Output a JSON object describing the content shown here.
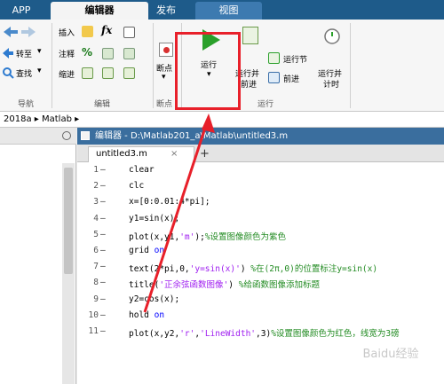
{
  "tabs": {
    "app": "APP",
    "editor": "编辑器",
    "publish": "发布",
    "view": "视图"
  },
  "ribbon": {
    "nav": {
      "forward": "转至",
      "find": "查找",
      "group": "导航"
    },
    "edit": {
      "insert": "插入",
      "comment": "注释",
      "indent": "缩进",
      "fx": "fx",
      "group": "编辑"
    },
    "breakpoint": {
      "label": "断点",
      "group": "断点"
    },
    "run": {
      "run": "运行",
      "run_advance_1": "运行并",
      "run_advance_2": "前进",
      "run_section": "运行节",
      "advance": "前进",
      "run_time_1": "运行并",
      "run_time_2": "计时",
      "group": "运行"
    }
  },
  "address": {
    "path1": "2018a",
    "sep": "▸",
    "path2": "Matlab",
    "end": "▸"
  },
  "editor": {
    "title": "编辑器 - D:\\Matlab201_a\\Matlab\\untitled3.m",
    "doc_tab": "untitled3.m",
    "close": "×",
    "add": "+",
    "lines": [
      {
        "n": "1",
        "code": "clear"
      },
      {
        "n": "2",
        "code": "clc"
      },
      {
        "n": "3",
        "code": "x=[0:0.01:4*pi];"
      },
      {
        "n": "4",
        "code": "y1=sin(x);"
      },
      {
        "n": "5",
        "pre": "plot(x,y1,",
        "str": "'m'",
        "post": ");",
        "cmt": "%设置图像颜色为紫色"
      },
      {
        "n": "6",
        "pre": "grid ",
        "kw": "on"
      },
      {
        "n": "7",
        "pre": "text(2*pi,0,",
        "str": "'y=sin(x)'",
        "post": ") ",
        "cmt": "%在(2π,0)的位置标注y=sin(x)"
      },
      {
        "n": "8",
        "pre": "title(",
        "str": "'正余弦函数图像'",
        "post": ") ",
        "cmt": "%给函数图像添加标题"
      },
      {
        "n": "9",
        "code": "y2=cos(x);"
      },
      {
        "n": "10",
        "pre": "hold ",
        "kw": "on"
      },
      {
        "n": "11",
        "pre": "plot(x,y2,",
        "str": "'r'",
        "post": ",",
        "str2": "'LineWidth'",
        "post2": ",3)",
        "cmt": "%设置图像颜色为红色，线宽为3磅"
      }
    ],
    "dash": "—"
  },
  "watermark": "Baidu经验",
  "colors": {
    "title_bar": "#1e5b8a",
    "highlight": "#e8202a",
    "run_green": "#2aa02a"
  }
}
